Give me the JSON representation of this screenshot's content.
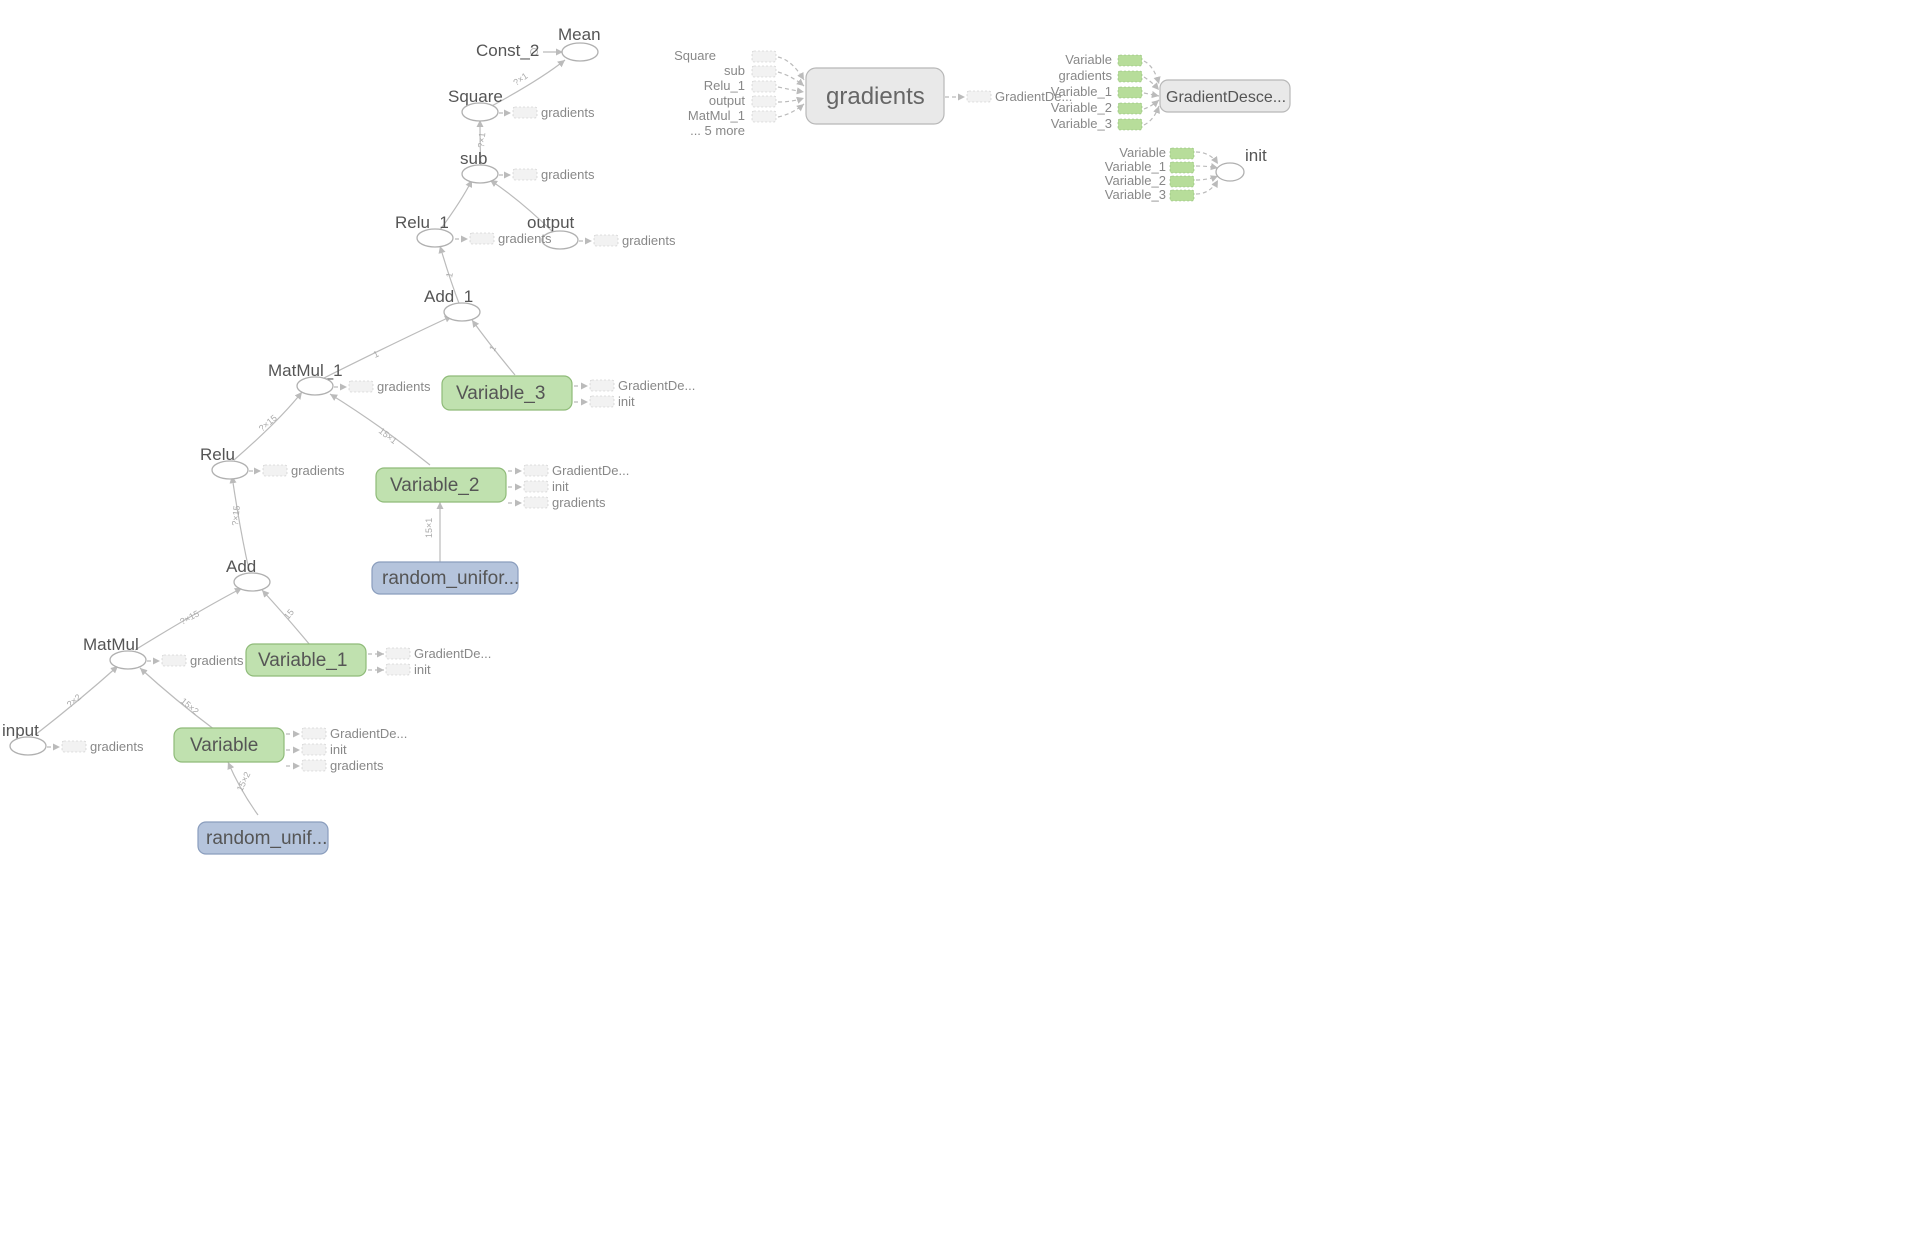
{
  "ops": {
    "mean": {
      "label": "Mean"
    },
    "const2": {
      "label": "Const_2"
    },
    "square": {
      "label": "Square"
    },
    "sub": {
      "label": "sub"
    },
    "relu1": {
      "label": "Relu_1"
    },
    "output": {
      "label": "output"
    },
    "add1": {
      "label": "Add_1"
    },
    "matmul1": {
      "label": "MatMul_1"
    },
    "relu": {
      "label": "Relu"
    },
    "add": {
      "label": "Add"
    },
    "matmul": {
      "label": "MatMul"
    },
    "input": {
      "label": "input"
    },
    "init": {
      "label": "init"
    }
  },
  "blocks": {
    "variable3": {
      "label": "Variable_3"
    },
    "variable2": {
      "label": "Variable_2"
    },
    "variable1": {
      "label": "Variable_1"
    },
    "variable": {
      "label": "Variable"
    },
    "randunif2": {
      "label": "random_unifor..."
    },
    "randunif": {
      "label": "random_unif..."
    },
    "gradients": {
      "label": "gradients"
    },
    "graddescent": {
      "label": "GradientDesce..."
    }
  },
  "portLabels": {
    "gradients": "gradients",
    "init": "init",
    "gradientDe": "GradientDe...",
    "square": "Square",
    "sub": "sub",
    "relu1": "Relu_1",
    "output": "output",
    "matmul1": "MatMul_1",
    "more5": "... 5 more",
    "variable": "Variable",
    "variable1": "Variable_1",
    "variable2": "Variable_2",
    "variable3": "Variable_3"
  },
  "edgeAnnots": {
    "qx1a": "?×1",
    "qx1b": "?×1",
    "onex1": "1",
    "onex1b": "1",
    "qx15": "?×15",
    "fifteen1": "15×1",
    "one": "1",
    "fifteenx2": "15×2",
    "qx2": "?×2",
    "fifteen": "15"
  }
}
